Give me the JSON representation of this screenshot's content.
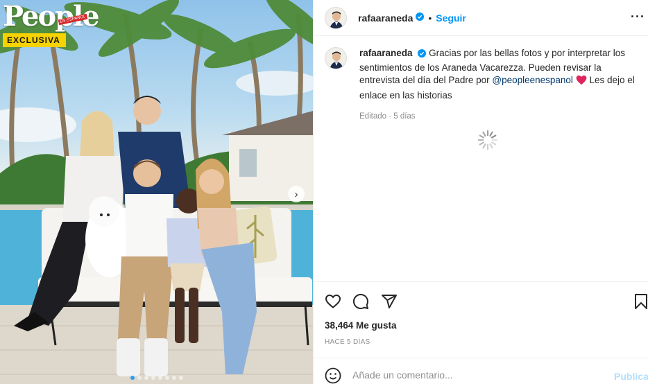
{
  "photo": {
    "brand": "People",
    "brand_sub": "EN ESPAÑOL",
    "tag": "EXCLUSIVA",
    "slide_count": 8,
    "active_slide": 1
  },
  "post": {
    "username": "rafaaraneda",
    "verified": true,
    "separator": "•",
    "follow_label": "Seguir",
    "more_icon": "more-horizontal-icon"
  },
  "caption": {
    "username": "rafaaraneda",
    "text_before": "Gracias por las bellas fotos y por interpretar los sentimientos de los Araneda Vacarezza. Pueden revisar la entrevista del día del Padre por ",
    "mention": "@peopleenespanol",
    "text_after": " Les dejo el enlace en las historias",
    "edited_label": "Editado · 5 días"
  },
  "engagement": {
    "likes": "38,464 Me gusta",
    "time": "HACE 5 DÍAS"
  },
  "comment_box": {
    "placeholder": "Añade un comentario...",
    "publish_label": "Publicar"
  },
  "colors": {
    "accent": "#0095f6",
    "link": "#00376b",
    "muted": "#8e8e8e",
    "publish_disabled": "#b2dffc",
    "heart": "#ed4956",
    "exclusive_yellow": "#f5d200"
  }
}
